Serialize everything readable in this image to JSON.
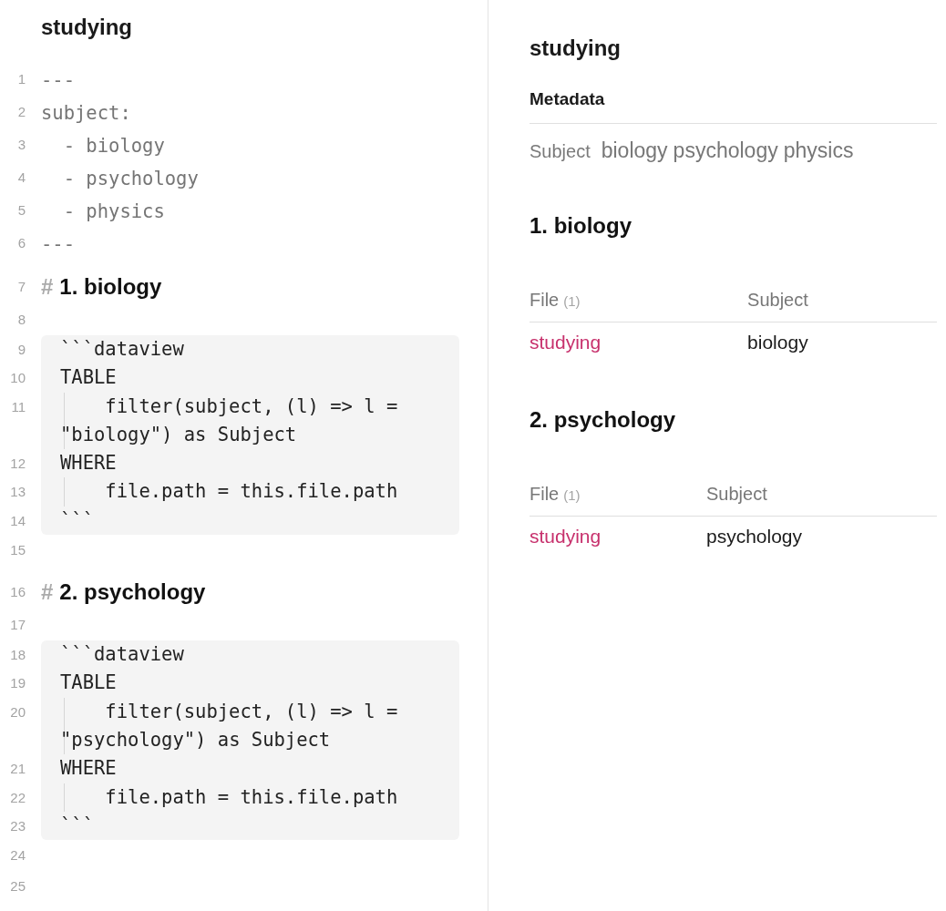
{
  "editor": {
    "title": "studying",
    "blocks": [
      {
        "kind": "frontmatter",
        "lines": [
          {
            "number": "1",
            "text": "---"
          },
          {
            "number": "2",
            "text": "subject:"
          },
          {
            "number": "3",
            "text": "  - biology"
          },
          {
            "number": "4",
            "text": "  - psychology"
          },
          {
            "number": "5",
            "text": "  - physics"
          },
          {
            "number": "6",
            "text": "---"
          }
        ]
      },
      {
        "kind": "heading",
        "number": "7",
        "marker": "#",
        "text": "1. biology"
      },
      {
        "kind": "blank",
        "number": "8"
      },
      {
        "kind": "code",
        "lines": [
          {
            "number": "9",
            "text": "```dataview",
            "indented": false
          },
          {
            "number": "10",
            "text": "TABLE",
            "indented": false
          },
          {
            "number": "11",
            "text": "filter(subject, (l) => l = \"biology\") as Subject",
            "indented": true
          },
          {
            "number": "12",
            "text": "WHERE",
            "indented": false
          },
          {
            "number": "13",
            "text": "file.path = this.file.path",
            "indented": true
          },
          {
            "number": "14",
            "text": "```",
            "indented": false
          }
        ]
      },
      {
        "kind": "blank",
        "number": "15"
      },
      {
        "kind": "heading",
        "number": "16",
        "marker": "#",
        "text": "2. psychology"
      },
      {
        "kind": "blank",
        "number": "17"
      },
      {
        "kind": "code",
        "lines": [
          {
            "number": "18",
            "text": "```dataview",
            "indented": false
          },
          {
            "number": "19",
            "text": "TABLE",
            "indented": false
          },
          {
            "number": "20",
            "text": "filter(subject, (l) => l = \"psychology\") as Subject",
            "indented": true
          },
          {
            "number": "21",
            "text": "WHERE",
            "indented": false
          },
          {
            "number": "22",
            "text": "file.path = this.file.path",
            "indented": true
          },
          {
            "number": "23",
            "text": "```",
            "indented": false
          }
        ]
      },
      {
        "kind": "blank",
        "number": "24"
      },
      {
        "kind": "blank",
        "number": "25"
      }
    ]
  },
  "preview": {
    "title": "studying",
    "metadata": {
      "heading": "Metadata",
      "properties": [
        {
          "key": "Subject",
          "values": [
            "biology",
            "psychology",
            "physics"
          ]
        }
      ]
    },
    "sections": [
      {
        "heading": "1. biology",
        "table": {
          "columns": [
            {
              "label": "File",
              "count": "(1)"
            },
            {
              "label": "Subject"
            }
          ],
          "rows": [
            {
              "cells": [
                {
                  "kind": "link",
                  "text": "studying"
                },
                {
                  "kind": "text",
                  "text": "biology"
                }
              ]
            }
          ]
        }
      },
      {
        "heading": "2. psychology",
        "table": {
          "columns": [
            {
              "label": "File",
              "count": "(1)"
            },
            {
              "label": "Subject"
            }
          ],
          "rows": [
            {
              "cells": [
                {
                  "kind": "link",
                  "text": "studying"
                },
                {
                  "kind": "text",
                  "text": "psychology"
                }
              ]
            }
          ]
        }
      }
    ]
  }
}
